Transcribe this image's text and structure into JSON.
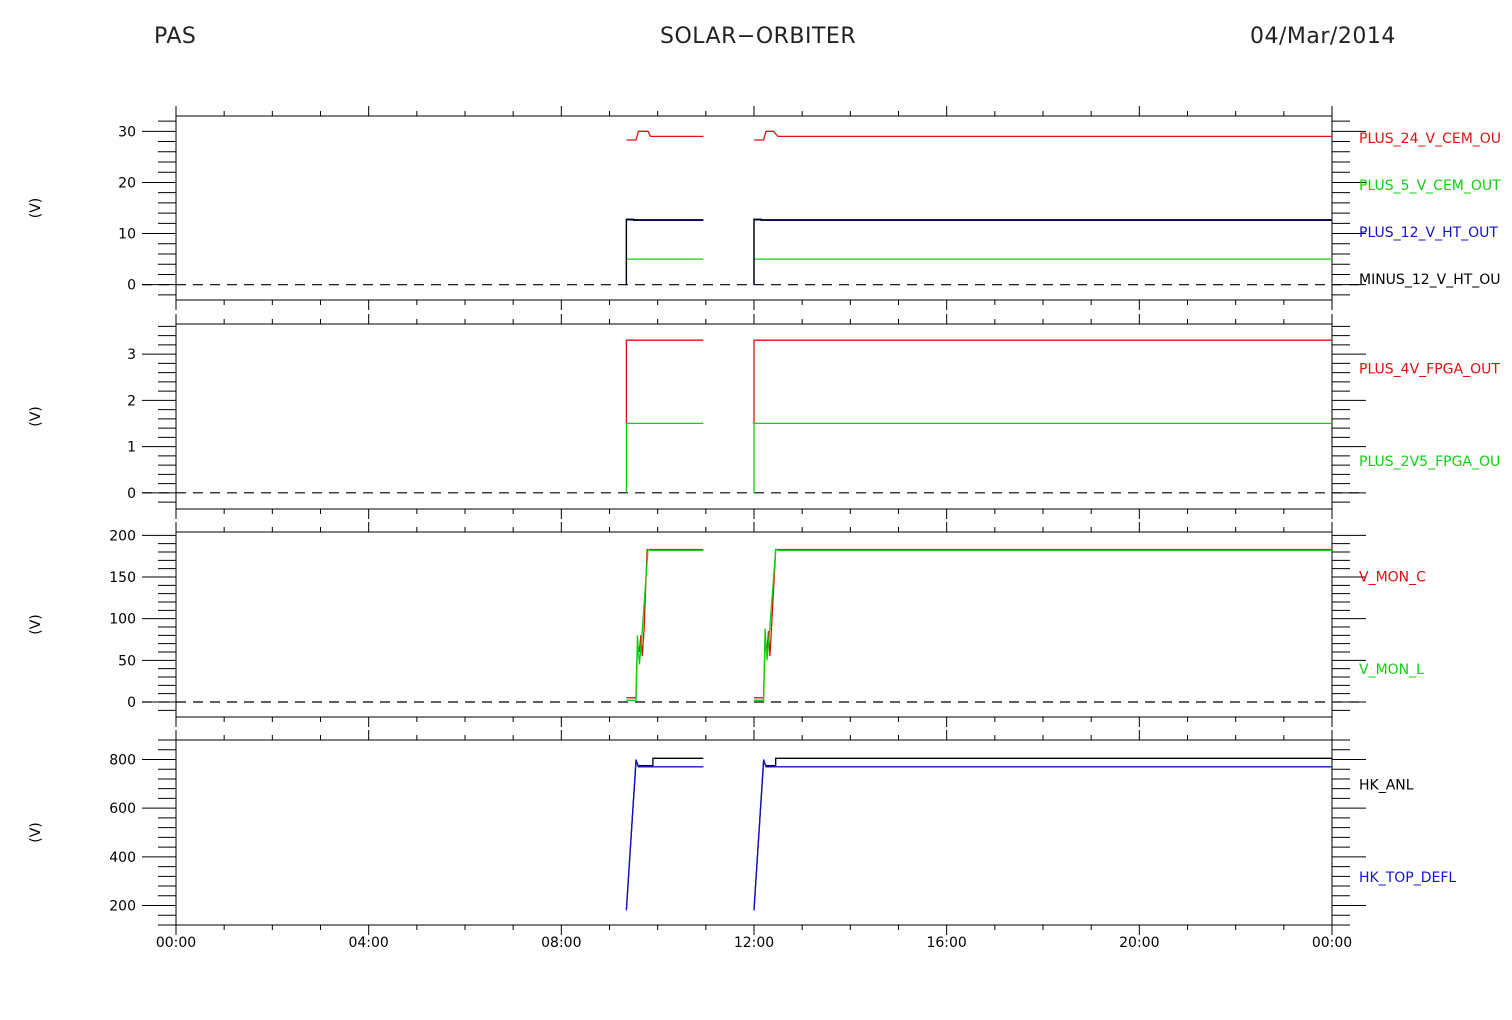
{
  "header": {
    "left": "PAS",
    "center": "SOLAR−ORBITER",
    "right": "04/Mar/2014"
  },
  "colors": {
    "red": "#e01010",
    "green": "#10d010",
    "blue": "#1414c8",
    "black": "#000000"
  },
  "x_axis": {
    "range_hours": [
      0,
      24
    ],
    "ticks": [
      {
        "h": 0,
        "label": "00:00"
      },
      {
        "h": 4,
        "label": "04:00"
      },
      {
        "h": 8,
        "label": "08:00"
      },
      {
        "h": 12,
        "label": "12:00"
      },
      {
        "h": 16,
        "label": "16:00"
      },
      {
        "h": 20,
        "label": "20:00"
      },
      {
        "h": 24,
        "label": "00:00"
      }
    ]
  },
  "chart_data": [
    {
      "type": "line",
      "ylabel": "(V)",
      "ylim": [
        -3,
        33
      ],
      "yticks": [
        0,
        10,
        20,
        30
      ],
      "zero_line": true,
      "series": [
        {
          "name": "PLUS_24_V_CEM_OU",
          "color": "red",
          "segments": [
            {
              "x": [
                9.35,
                9.55,
                9.6,
                9.8,
                9.85,
                10.95
              ],
              "y": [
                28.3,
                28.3,
                30,
                30,
                29,
                29
              ]
            },
            {
              "x": [
                12.0,
                12.2,
                12.25,
                12.4,
                12.5,
                24.0
              ],
              "y": [
                28.3,
                28.3,
                30,
                30,
                29,
                29
              ]
            }
          ]
        },
        {
          "name": "PLUS_5_V_CEM_OUT",
          "color": "green",
          "segments": [
            {
              "x": [
                9.35,
                10.95
              ],
              "y": [
                5,
                5
              ]
            },
            {
              "x": [
                12.0,
                24.0
              ],
              "y": [
                5,
                5
              ]
            }
          ]
        },
        {
          "name": "PLUS_12_V_HT_OUT",
          "color": "blue",
          "segments": [
            {
              "x": [
                9.35,
                9.35,
                9.5,
                9.5,
                10.95
              ],
              "y": [
                0,
                12.8,
                12.8,
                12.6,
                12.6
              ]
            },
            {
              "x": [
                12.0,
                12.0,
                12.15,
                12.15,
                24.0
              ],
              "y": [
                0,
                12.8,
                12.8,
                12.6,
                12.6
              ]
            }
          ]
        },
        {
          "name": "MINUS_12_V_HT_OU",
          "color": "black",
          "segments": [
            {
              "x": [
                9.35,
                9.35,
                10.95
              ],
              "y": [
                0,
                12.7,
                12.7
              ]
            },
            {
              "x": [
                12.0,
                12.0,
                24.0
              ],
              "y": [
                0,
                12.7,
                12.7
              ]
            }
          ]
        }
      ]
    },
    {
      "type": "line",
      "ylabel": "(V)",
      "ylim": [
        -0.35,
        3.65
      ],
      "yticks": [
        0,
        1,
        2,
        3
      ],
      "zero_line": true,
      "series": [
        {
          "name": "PLUS_4V_FPGA_OUT",
          "color": "red",
          "segments": [
            {
              "x": [
                9.35,
                9.35,
                10.95
              ],
              "y": [
                1.5,
                3.3,
                3.3
              ]
            },
            {
              "x": [
                12.0,
                12.0,
                24.0
              ],
              "y": [
                1.5,
                3.3,
                3.3
              ]
            }
          ]
        },
        {
          "name": "PLUS_2V5_FPGA_OU",
          "color": "green",
          "segments": [
            {
              "x": [
                9.35,
                9.35,
                10.95
              ],
              "y": [
                0,
                1.5,
                1.5
              ]
            },
            {
              "x": [
                12.0,
                12.0,
                24.0
              ],
              "y": [
                0,
                1.5,
                1.5
              ]
            }
          ]
        }
      ]
    },
    {
      "type": "line",
      "ylabel": "(V)",
      "ylim": [
        -18,
        204
      ],
      "yticks": [
        0,
        50,
        100,
        150,
        200
      ],
      "zero_line": true,
      "series": [
        {
          "name": "V_MON_C",
          "color": "red",
          "segments": [
            {
              "x": [
                9.35,
                9.55,
                9.58,
                9.62,
                9.65,
                9.68,
                9.72,
                9.78,
                10.95
              ],
              "y": [
                5,
                5,
                70,
                60,
                80,
                55,
                90,
                183,
                183
              ]
            },
            {
              "x": [
                12.0,
                12.2,
                12.23,
                12.27,
                12.3,
                12.33,
                12.37,
                12.45,
                24.0
              ],
              "y": [
                5,
                5,
                75,
                60,
                85,
                55,
                95,
                183,
                183
              ]
            }
          ]
        },
        {
          "name": "V_MON_L",
          "color": "green",
          "segments": [
            {
              "x": [
                9.35,
                9.55,
                9.58,
                9.62,
                9.66,
                9.8,
                9.85,
                10.95
              ],
              "y": [
                2,
                2,
                80,
                45,
                70,
                183,
                182,
                182
              ]
            },
            {
              "x": [
                12.0,
                12.2,
                12.23,
                12.27,
                12.31,
                12.45,
                12.5,
                24.0
              ],
              "y": [
                2,
                2,
                88,
                50,
                75,
                183,
                182,
                182
              ]
            }
          ]
        }
      ]
    },
    {
      "type": "line",
      "ylabel": "(V)",
      "ylim": [
        120,
        880
      ],
      "yticks": [
        200,
        400,
        600,
        800
      ],
      "zero_line": false,
      "series": [
        {
          "name": "HK_ANL",
          "color": "black",
          "segments": [
            {
              "x": [
                9.35,
                9.55,
                9.6,
                9.9,
                9.9,
                10.95
              ],
              "y": [
                185,
                790,
                775,
                775,
                805,
                805
              ]
            },
            {
              "x": [
                12.0,
                12.2,
                12.25,
                12.45,
                12.45,
                24.0
              ],
              "y": [
                185,
                790,
                775,
                775,
                805,
                805
              ]
            }
          ]
        },
        {
          "name": "HK_TOP_DEFL",
          "color": "blue",
          "segments": [
            {
              "x": [
                9.35,
                9.55,
                9.6,
                10.95
              ],
              "y": [
                180,
                800,
                770,
                770
              ]
            },
            {
              "x": [
                12.0,
                12.2,
                12.25,
                24.0
              ],
              "y": [
                180,
                800,
                770,
                770
              ]
            }
          ]
        }
      ]
    }
  ]
}
